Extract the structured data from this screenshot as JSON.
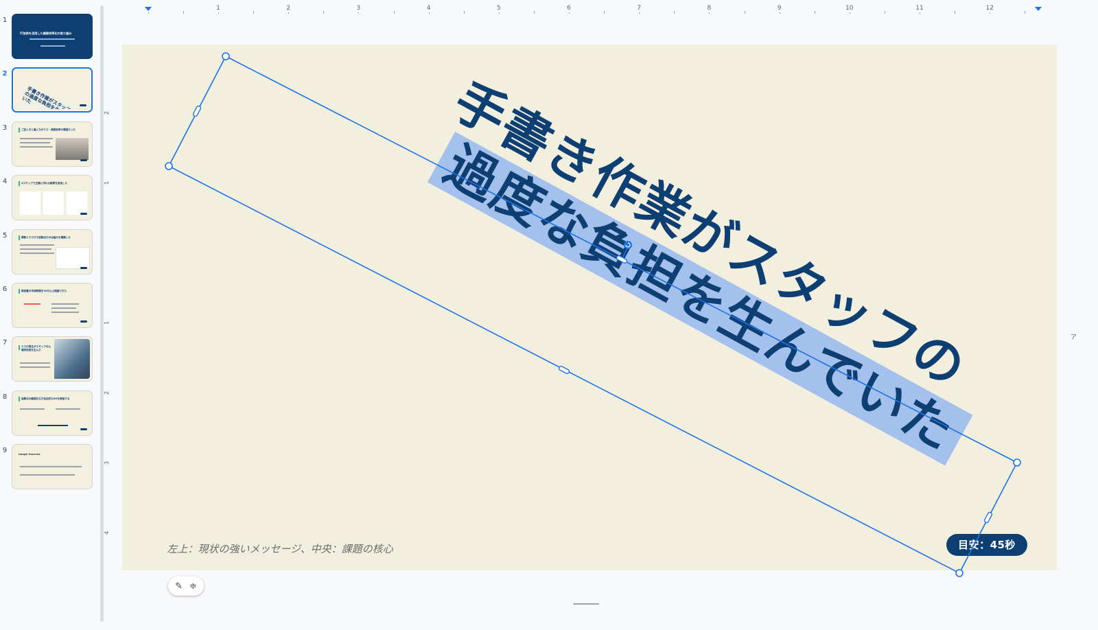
{
  "filmstrip": {
    "slides": [
      {
        "num": "1",
        "title": "IT技術を活用した業務効率化の取り組み"
      },
      {
        "num": "2",
        "title": "手書き作業がスタッフの過度な負担を生んでいた"
      },
      {
        "num": "3",
        "title": "ご記入力と重入力がミス・業務負荷の要因だった"
      },
      {
        "num": "4",
        "title": "3ステップで正確に作れる帳票を目指した"
      },
      {
        "num": "5",
        "title": "関数とマクロで自動出力の仕組みを構築した"
      },
      {
        "num": "6",
        "title": "報告書の作成時間を30分以上短縮できた"
      },
      {
        "num": "7",
        "title": "ミスの発生がスタッフの心理的負担を生んだ"
      },
      {
        "num": "8",
        "title": "自動化の範囲を広げ全社的なDXを推進する"
      },
      {
        "num": "9",
        "title": "Image Sources"
      }
    ],
    "selected_index": 2
  },
  "ruler": {
    "numbers": [
      "1",
      "2",
      "3",
      "4",
      "5",
      "6",
      "7",
      "8",
      "9",
      "10",
      "11",
      "12"
    ],
    "vertical_numbers": [
      "2",
      "1",
      "1",
      "2",
      "3",
      "4"
    ]
  },
  "slide": {
    "title_line1": "手書き作業がスタッフの",
    "title_line2": "過度な負担を生んでいた",
    "speaker_note": "左上：現状の強いメッセージ、中央：課題の核心",
    "duration_badge": "目安：45秒"
  },
  "toolbar": {
    "magic_icon_glyph": "✎",
    "align_icon_glyph": "≑"
  },
  "right_edge_char": "ア",
  "colors": {
    "brand_navy": "#0e3f73",
    "accent_teal": "#1fbf8f",
    "slide_bg": "#f3efdf",
    "selection_blue": "#1a73e8",
    "highlight": "#a4c0ec"
  }
}
